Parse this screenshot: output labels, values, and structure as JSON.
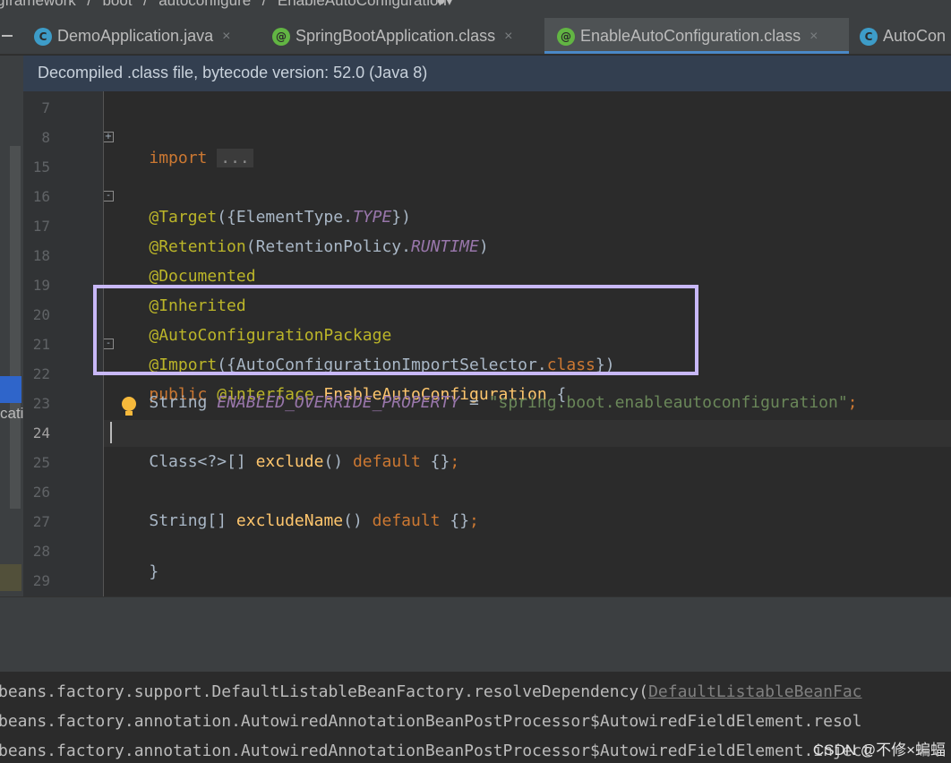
{
  "breadcrumb": {
    "items": [
      "gframework",
      "/",
      "boot",
      "/",
      "autoconfigure",
      "/",
      "EnableAutoConfiguration"
    ]
  },
  "tabs": [
    {
      "label": "DemoApplication.java",
      "icon": "class-c-icon",
      "close": "×"
    },
    {
      "label": "SpringBootApplication.class",
      "icon": "annotation-icon",
      "close": "×"
    },
    {
      "label": "EnableAutoConfiguration.class",
      "icon": "annotation-icon",
      "close": "×",
      "active": true
    },
    {
      "label": "AutoCon",
      "icon": "class-c-icon"
    }
  ],
  "banner": {
    "text": "Decompiled .class file, bytecode version: 52.0 (Java 8)"
  },
  "left_strip": {
    "text": "cati"
  },
  "gutter": {
    "lines": [
      "7",
      "8",
      "15",
      "16",
      "17",
      "18",
      "19",
      "20",
      "21",
      "22",
      "23",
      "24",
      "25",
      "26",
      "27",
      "28",
      "29"
    ],
    "current": "24"
  },
  "code": {
    "l8_kw": "import",
    "l8_fold": "...",
    "l16_ann": "@Target",
    "l16_a": "({ElementType.",
    "l16_cst": "TYPE",
    "l16_b": "})",
    "l17_ann": "@Retention",
    "l17_a": "(RetentionPolicy.",
    "l17_cst": "RUNTIME",
    "l17_b": ")",
    "l18_ann": "@Documented",
    "l19_ann": "@Inherited",
    "l20_ann": "@AutoConfigurationPackage",
    "l21_ann": "@Import",
    "l21_a": "({AutoConfigurationImportSelector.",
    "l21_kw": "class",
    "l21_b": "})",
    "l22_kw1": "public",
    "l22_ann": "@interface",
    "l22_name": "EnableAutoConfiguration",
    "l22_brace": "{",
    "l23_type": "String",
    "l23_cst": "ENABLED_OVERRIDE_PROPERTY",
    "l23_eq": "=",
    "l23_str": "\"spring.boot.enableautoconfiguration\"",
    "l23_semi": ";",
    "l25_type": "Class<?>[]",
    "l25_fn": "exclude",
    "l25_paren": "()",
    "l25_kw": "default",
    "l25_body": "{}",
    "l25_semi": ";",
    "l27_type": "String[]",
    "l27_fn": "excludeName",
    "l27_paren": "()",
    "l27_kw": "default",
    "l27_body": "{}",
    "l27_semi": ";",
    "l28": "}"
  },
  "console": {
    "lines": [
      {
        "text": "beans.factory.support.DefaultListableBeanFactory.resolveDependency(",
        "link": "DefaultListableBeanFac"
      },
      {
        "text": "beans.factory.annotation.AutowiredAnnotationBeanPostProcessor$AutowiredFieldElement.resol"
      },
      {
        "text": "beans.factory.annotation.AutowiredAnnotationBeanPostProcessor$AutowiredFieldElement.inject"
      }
    ]
  },
  "watermark": "CSDN @不修×蝙蝠",
  "colors": {
    "keyword": "#cc7832",
    "annotation": "#bbb529",
    "constant": "#9876aa",
    "string": "#6a8759",
    "method": "#ffc66d",
    "highlight_box": "#c8b8f8",
    "active_tab_underline": "#4a88c7"
  }
}
